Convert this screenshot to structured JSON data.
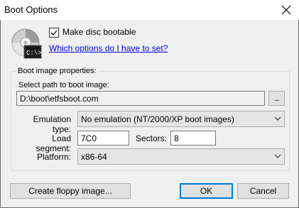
{
  "window": {
    "title": "Boot Options"
  },
  "bootable": {
    "label": "Make disc bootable",
    "checked": true
  },
  "help_link": "Which options do I have to set?",
  "group": {
    "title": "Boot image properties:",
    "path_label": "Select path to boot image:",
    "path_value": "D:\\boot\\etfsboot.com",
    "browse_label": "..."
  },
  "emulation": {
    "label": "Emulation type:",
    "value": "No emulation (NT/2000/XP boot images)"
  },
  "load_segment": {
    "label": "Load segment:",
    "value": "7C0"
  },
  "sectors": {
    "label": "Sectors:",
    "value": "8"
  },
  "platform": {
    "label": "Platform:",
    "value": "x86-64"
  },
  "buttons": {
    "floppy": "Create floppy image...",
    "ok": "OK",
    "cancel": "Cancel"
  },
  "colors": {
    "link": "#0000ee",
    "default_button_border": "#0078d7"
  },
  "icons": {
    "disc": "disc-console-icon",
    "close": "close-icon",
    "chevron": "chevron-down-icon",
    "check": "checkmark-icon"
  }
}
